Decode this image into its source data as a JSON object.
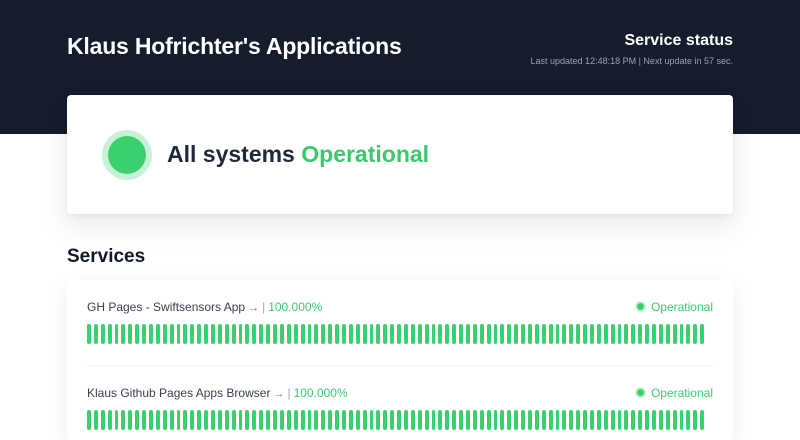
{
  "header": {
    "app_title": "Klaus Hofrichter's Applications",
    "status_title": "Service status",
    "last_updated": "Last updated 12:48:18 PM | Next update in 57 sec."
  },
  "overall": {
    "prefix": "All systems",
    "status": "Operational",
    "status_color": "#3ac96e"
  },
  "services_section": {
    "title": "Services",
    "items": [
      {
        "name": "GH Pages - Swiftsensors App",
        "arrow": "→",
        "separator": "|",
        "uptime": "100.000%",
        "status": "Operational",
        "bar_color": "#3ad06d"
      },
      {
        "name": "Klaus Github Pages Apps Browser",
        "arrow": "→",
        "separator": "|",
        "uptime": "100.000%",
        "status": "Operational",
        "bar_color": "#3ad06d"
      }
    ]
  }
}
